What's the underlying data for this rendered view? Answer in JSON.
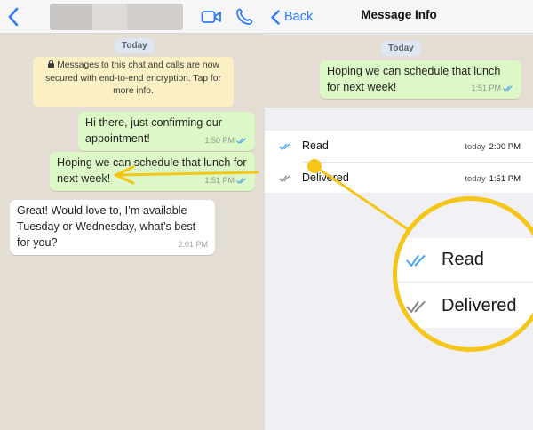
{
  "chat": {
    "date_label": "Today",
    "encryption_notice": "Messages to this chat and calls are now secured with end-to-end encryption. Tap for more info.",
    "messages": [
      {
        "text": "Hi there, just confirming our appointment!",
        "time": "1:50 PM",
        "direction": "outgoing",
        "status": "read"
      },
      {
        "text": "Hoping we can schedule that lunch for next week!",
        "time": "1:51 PM",
        "direction": "outgoing",
        "status": "read"
      },
      {
        "text": "Great!  Would love to, I’m available Tuesday or Wednesday, what’s best for you?",
        "time": "2:01 PM",
        "direction": "incoming"
      }
    ],
    "icons": {
      "back": "chevron-left-icon",
      "video": "video-call-icon",
      "phone": "phone-call-icon"
    }
  },
  "info": {
    "back_label": "Back",
    "title": "Message Info",
    "date_label": "Today",
    "message": {
      "text": "Hoping we can schedule that lunch for next week!",
      "time": "1:51 PM"
    },
    "rows": [
      {
        "label": "Read",
        "day": "today",
        "time": "2:00 PM",
        "tick_color": "#4fa3e8"
      },
      {
        "label": "Delivered",
        "day": "today",
        "time": "1:51 PM",
        "tick_color": "#8a8a8a"
      }
    ]
  },
  "magnifier": {
    "rows": [
      {
        "label": "Read",
        "tick_color": "#4fa3e8"
      },
      {
        "label": "Delivered",
        "tick_color": "#8a8a8a"
      }
    ]
  },
  "colors": {
    "accent_blue": "#2f7cf6",
    "highlight_yellow": "#f5c518",
    "outgoing_bubble": "#dcf8c6",
    "read_tick": "#4fa3e8"
  }
}
